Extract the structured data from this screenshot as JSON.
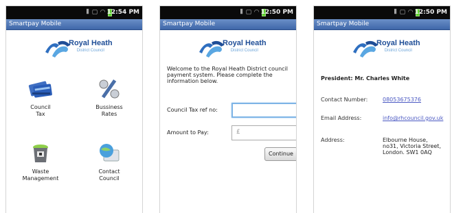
{
  "screens": [
    {
      "status_time": "12:54 PM",
      "app_title": "Smartpay Mobile",
      "logo": {
        "line1": "Royal Heath",
        "line2": "District Council"
      },
      "menu": [
        {
          "label": "Council\nTax",
          "icon": "credit-cards-icon"
        },
        {
          "label": "Bussiness\nRates",
          "icon": "percent-icon"
        },
        {
          "label": "Waste\nManagement",
          "icon": "waste-bin-icon"
        },
        {
          "label": "Contact\nCouncil",
          "icon": "contact-globe-icon"
        }
      ]
    },
    {
      "status_time": "12:50 PM",
      "app_title": "Smartpay Mobile",
      "logo": {
        "line1": "Royal Heath",
        "line2": "District Council"
      },
      "welcome": "Welcome to the Royal Heath District council payment system. Please complete the information below.",
      "fields": [
        {
          "label": "Council Tax ref no:",
          "value": "",
          "placeholder": ""
        },
        {
          "label": "Amount to Pay:",
          "value": "",
          "placeholder": "£"
        }
      ],
      "continue_label": "Continue"
    },
    {
      "status_time": "12:50 PM",
      "app_title": "Smartpay Mobile",
      "logo": {
        "line1": "Royal Heath",
        "line2": "District Council"
      },
      "president": "President: Mr. Charles White",
      "contacts": [
        {
          "label": "Contact Number:",
          "value": "08053675376",
          "link": true
        },
        {
          "label": "Email Address:",
          "value": "info@rhcouncil.gov.uk",
          "link": true
        },
        {
          "label": "Address:",
          "value": "Elbourne House,\nno31, Victoria Street,\nLondon. SW1 0AQ",
          "link": false
        }
      ]
    }
  ],
  "colors": {
    "titlebar": "#4a72b2",
    "brand_blue": "#1f4e97",
    "link": "#4a58c2",
    "focus": "#7db4e6"
  }
}
